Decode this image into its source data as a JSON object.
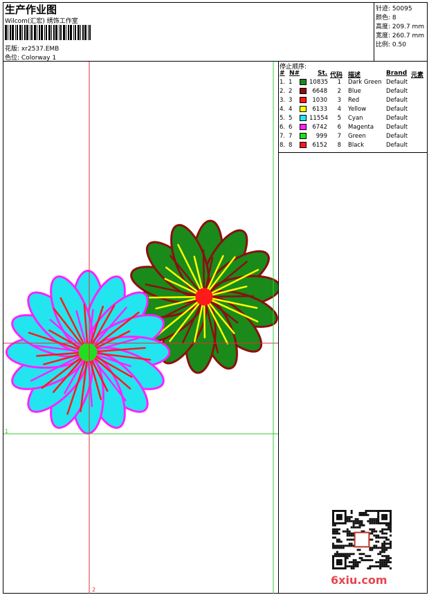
{
  "header": {
    "title": "生产作业图",
    "subtitle": "Wilcom(汇宏) 绣饰工作室",
    "file_label": "花版:",
    "file_value": "xr2537.EMB",
    "colorway_label": "色位:",
    "colorway_value": "Colorway 1"
  },
  "stats": [
    {
      "label": "针迹:",
      "value": "50095"
    },
    {
      "label": "颜色:",
      "value": "8"
    },
    {
      "label": "高度:",
      "value": "209.7 mm"
    },
    {
      "label": "宽度:",
      "value": "260.7 mm"
    },
    {
      "label": "比例:",
      "value": "0.50"
    }
  ],
  "stop_table": {
    "title": "停止顺序:",
    "headers": {
      "num": "#",
      "n": "N#",
      "st": "St.",
      "code": "代码",
      "desc": "描述",
      "brand": "Brand",
      "elem": "元素"
    },
    "rows": [
      {
        "num": "1.",
        "n": "1",
        "color": "#1a8a1a",
        "st": "10835",
        "code": "1",
        "desc": "Dark Green",
        "brand": "Default"
      },
      {
        "num": "2.",
        "n": "2",
        "color": "#8b1010",
        "st": "6648",
        "code": "2",
        "desc": "Blue",
        "brand": "Default"
      },
      {
        "num": "3.",
        "n": "3",
        "color": "#ff1a1a",
        "st": "1030",
        "code": "3",
        "desc": "Red",
        "brand": "Default"
      },
      {
        "num": "4.",
        "n": "4",
        "color": "#ffff00",
        "st": "6133",
        "code": "4",
        "desc": "Yellow",
        "brand": "Default"
      },
      {
        "num": "5.",
        "n": "5",
        "color": "#22e5f0",
        "st": "11554",
        "code": "5",
        "desc": "Cyan",
        "brand": "Default"
      },
      {
        "num": "6.",
        "n": "6",
        "color": "#ff22ff",
        "st": "6742",
        "code": "6",
        "desc": "Magenta",
        "brand": "Default"
      },
      {
        "num": "7.",
        "n": "7",
        "color": "#22dd22",
        "st": "999",
        "code": "7",
        "desc": "Green",
        "brand": "Default"
      },
      {
        "num": "8.",
        "n": "8",
        "color": "#ff1a1a",
        "st": "6152",
        "code": "8",
        "desc": "Black",
        "brand": "Default"
      }
    ]
  },
  "guides": {
    "label_1": "1",
    "label_2": "2"
  },
  "watermark": "6xiu.com",
  "colors": {
    "guide_red": "#e0303a",
    "guide_green": "#33cc33",
    "petal_cyan": "#22e5f0",
    "petal_green": "#1a8a1a"
  }
}
